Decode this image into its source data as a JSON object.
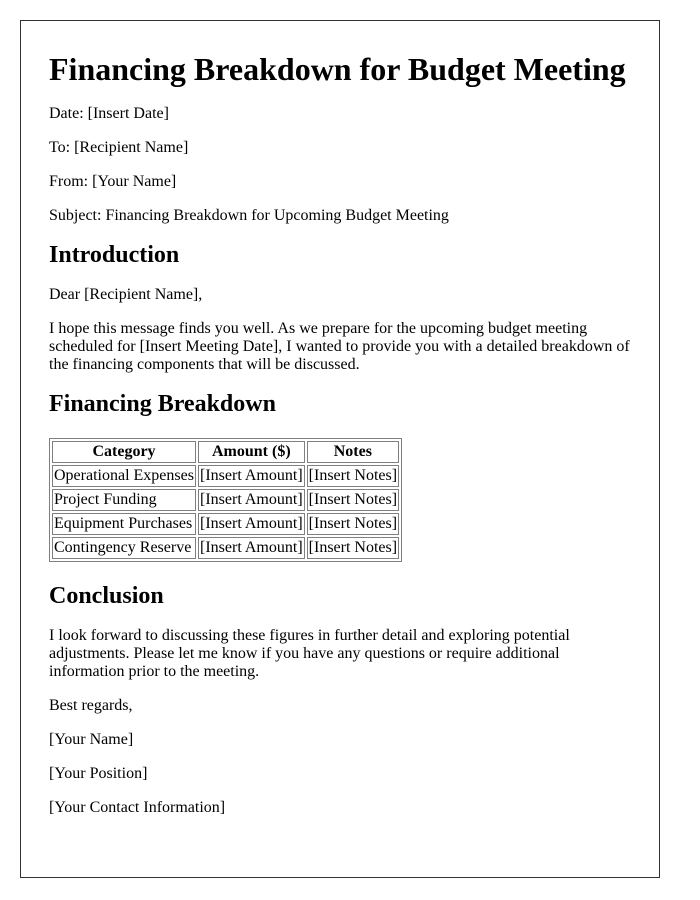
{
  "title": "Financing Breakdown for Budget Meeting",
  "header_fields": [
    {
      "label": "Date:",
      "value": "[Insert Date]",
      "text": "Date: [Insert Date]"
    },
    {
      "label": "To:",
      "value": "[Recipient Name]",
      "text": "To: [Recipient Name]"
    },
    {
      "label": "From:",
      "value": "[Your Name]",
      "text": "From: [Your Name]"
    },
    {
      "label": "Subject:",
      "value": "Financing Breakdown for Upcoming Budget Meeting",
      "text": "Subject: Financing Breakdown for Upcoming Budget Meeting"
    }
  ],
  "introduction": {
    "heading": "Introduction",
    "greeting": "Dear [Recipient Name],",
    "body": "I hope this message finds you well. As we prepare for the upcoming budget meeting scheduled for [Insert Meeting Date], I wanted to provide you with a detailed breakdown of the financing components that will be discussed."
  },
  "financing": {
    "heading": "Financing Breakdown",
    "columns": [
      "Category",
      "Amount ($)",
      "Notes"
    ],
    "rows": [
      [
        "Operational Expenses",
        "[Insert Amount]",
        "[Insert Notes]"
      ],
      [
        "Project Funding",
        "[Insert Amount]",
        "[Insert Notes]"
      ],
      [
        "Equipment Purchases",
        "[Insert Amount]",
        "[Insert Notes]"
      ],
      [
        "Contingency Reserve",
        "[Insert Amount]",
        "[Insert Notes]"
      ]
    ]
  },
  "conclusion": {
    "heading": "Conclusion",
    "body": "I look forward to discussing these figures in further detail and exploring potential adjustments. Please let me know if you have any questions or require additional information prior to the meeting.",
    "closing": "Best regards,",
    "signature": [
      "[Your Name]",
      "[Your Position]",
      "[Your Contact Information]"
    ]
  }
}
